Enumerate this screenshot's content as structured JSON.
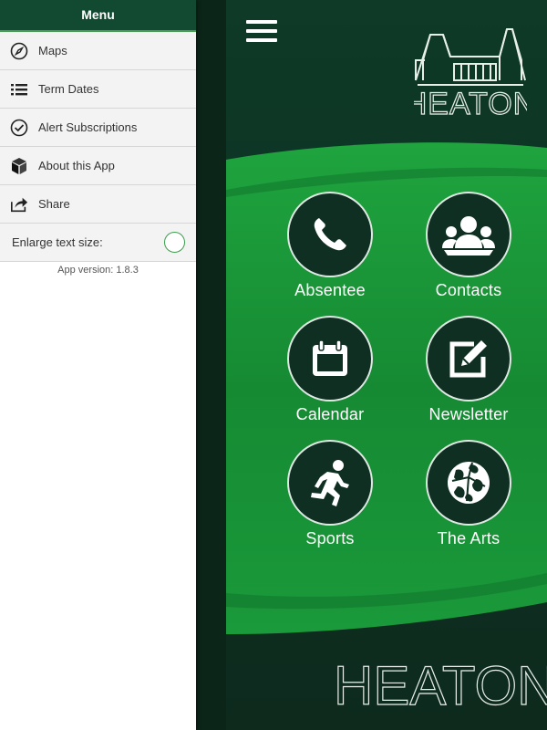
{
  "drawer": {
    "title": "Menu",
    "items": [
      {
        "label": "Maps",
        "icon": "compass-icon"
      },
      {
        "label": "Term Dates",
        "icon": "list-icon"
      },
      {
        "label": "Alert Subscriptions",
        "icon": "check-circle-icon"
      },
      {
        "label": "About this App",
        "icon": "cube-icon"
      },
      {
        "label": "Share",
        "icon": "share-icon"
      }
    ],
    "enlarge_label": "Enlarge text size:",
    "version": "App version: 1.8.3"
  },
  "app": {
    "logo_text": "HEATON",
    "footer_text": "HEATON",
    "tiles": [
      {
        "label": "Absentee",
        "icon": "phone-icon"
      },
      {
        "label": "Contacts",
        "icon": "people-icon"
      },
      {
        "label": "Calendar",
        "icon": "calendar-icon"
      },
      {
        "label": "Newsletter",
        "icon": "edit-icon"
      },
      {
        "label": "Sports",
        "icon": "running-icon"
      },
      {
        "label": "The Arts",
        "icon": "globe-icon"
      }
    ]
  },
  "colors": {
    "header_green": "#114a30",
    "band_green": "#1a9a3a",
    "panel_dark": "#0f3324",
    "toggle_border": "#3aa04a"
  }
}
